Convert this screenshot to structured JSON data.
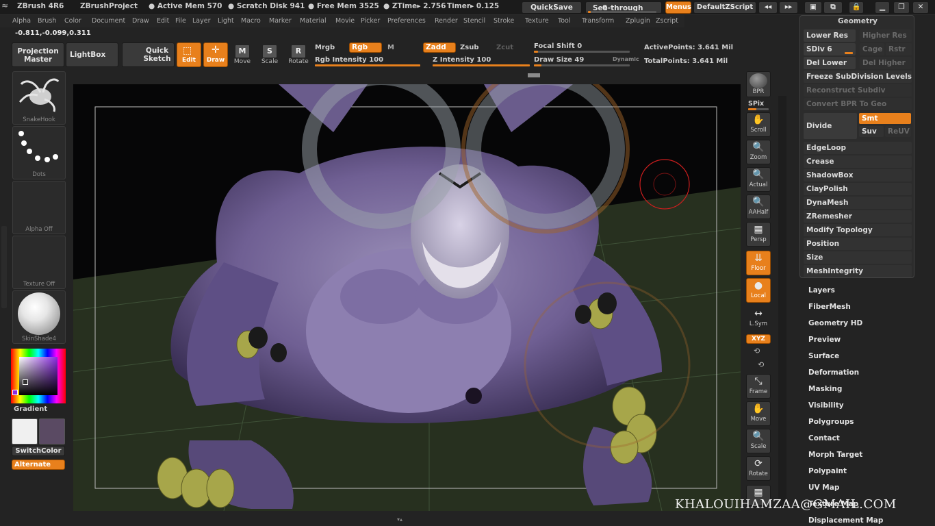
{
  "titlebar": {
    "app": "ZBrush 4R6",
    "project": "ZBrushProject",
    "active_mem": "● Active Mem 570",
    "scratch": "● Scratch Disk 941",
    "free_mem": "● Free Mem 3525",
    "ztime": "● ZTime▸ 2.756",
    "timer": "Timer▸ 0.125",
    "quicksave": "QuickSave",
    "see_through": "See-through",
    "see_through_value": "0",
    "menus": "Menus",
    "default_script": "DefaultZScript"
  },
  "menu": [
    "Alpha",
    "Brush",
    "Color",
    "Document",
    "Draw",
    "Edit",
    "File",
    "Layer",
    "Light",
    "Macro",
    "Marker",
    "Material",
    "Movie",
    "Picker",
    "Preferences",
    "Render",
    "Stencil",
    "Stroke",
    "Texture",
    "Tool",
    "Transform",
    "Zplugin",
    "Zscript"
  ],
  "coords": "-0.811,-0.099,0.311",
  "toolbar": {
    "projection_master": "Projection Master",
    "lightbox": "LightBox",
    "quick_sketch": "Quick Sketch",
    "edit": "Edit",
    "draw": "Draw",
    "move": "Move",
    "scale": "Scale",
    "rotate": "Rotate",
    "move_glyph": "M",
    "scale_glyph": "S",
    "rotate_glyph": "R",
    "mrgb": "Mrgb",
    "rgb": "Rgb",
    "m": "M",
    "zadd": "Zadd",
    "zsub": "Zsub",
    "zcut": "Zcut",
    "rgb_intensity": "Rgb Intensity 100",
    "z_intensity": "Z Intensity 100",
    "focal_shift": "Focal Shift 0",
    "draw_size": "Draw Size 49",
    "dynamic": "Dynamic",
    "active_points": "ActivePoints: 3.641  Mil",
    "total_points": "TotalPoints: 3.641  Mil"
  },
  "levels": {
    "rgb_intensity": 1.0,
    "z_intensity": 1.0,
    "focal_shift": 0.0,
    "draw_size": 0.08
  },
  "left": {
    "brush": "SnakeHook",
    "stroke": "Dots",
    "alpha": "Alpha  Off",
    "texture": "Texture  Off",
    "material": "SkinShade4",
    "gradient": "Gradient",
    "switch_color": "SwitchColor",
    "alternate": "Alternate"
  },
  "right_tools": {
    "bpr": "BPR",
    "spix": "SPix",
    "scroll": "Scroll",
    "zoom": "Zoom",
    "actual": "Actual",
    "aahalf": "AAHalf",
    "persp": "Persp",
    "floor": "Floor",
    "local": "Local",
    "lsym": "L.Sym",
    "xyz": "XYZ",
    "frame": "Frame",
    "move": "Move",
    "scale": "Scale",
    "rotate": "Rotate"
  },
  "geometry": {
    "title": "Geometry",
    "lower_res": "Lower Res",
    "higher_res": "Higher Res",
    "sdiv": "SDiv 6",
    "cage": "Cage",
    "rstr": "Rstr",
    "del_lower": "Del Lower",
    "del_higher": "Del Higher",
    "freeze": "Freeze SubDivision Levels",
    "reconstruct": "Reconstruct Subdiv",
    "convert_bpr": "Convert BPR To Geo",
    "divide": "Divide",
    "smt": "Smt",
    "suv": "Suv",
    "reuv": "ReUV",
    "items": [
      "EdgeLoop",
      "Crease",
      "ShadowBox",
      "ClayPolish",
      "DynaMesh",
      "ZRemesher",
      "Modify Topology",
      "Position",
      "Size",
      "MeshIntegrity"
    ]
  },
  "subpalettes": [
    "Layers",
    "FiberMesh",
    "Geometry HD",
    "Preview",
    "Surface",
    "Deformation",
    "Masking",
    "Visibility",
    "Polygroups",
    "Contact",
    "Morph Target",
    "Polypaint",
    "UV Map",
    "Texture Map",
    "Displacement Map"
  ],
  "watermark": "KHALOUIHAMZAA@GMAIL.COM",
  "colors": {
    "accent": "#e8801c",
    "model": "#6f5f93",
    "background": "#232323"
  }
}
